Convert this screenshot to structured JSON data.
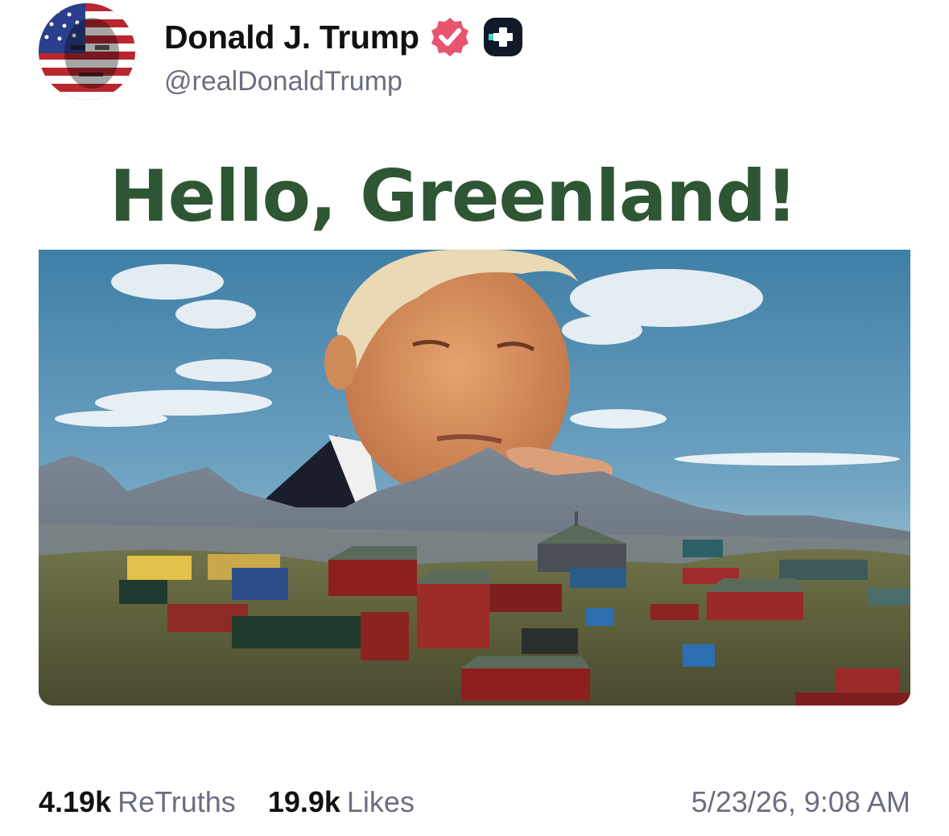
{
  "profile": {
    "display_name": "Donald J. Trump",
    "handle": "@realDonaldTrump",
    "avatar_icon": "flag-face-avatar",
    "verified_icon": "verified-badge-icon",
    "subscriber_icon": "plus-badge-icon",
    "verified_color": "#e8546f"
  },
  "post": {
    "image_headline": "Hello, Greenland!",
    "headline_color": "#2e5634"
  },
  "stats": {
    "retruths_count": "4.19k",
    "retruths_label": "ReTruths",
    "likes_count": "19.9k",
    "likes_label": "Likes",
    "timestamp": "5/23/26, 9:08 AM"
  }
}
